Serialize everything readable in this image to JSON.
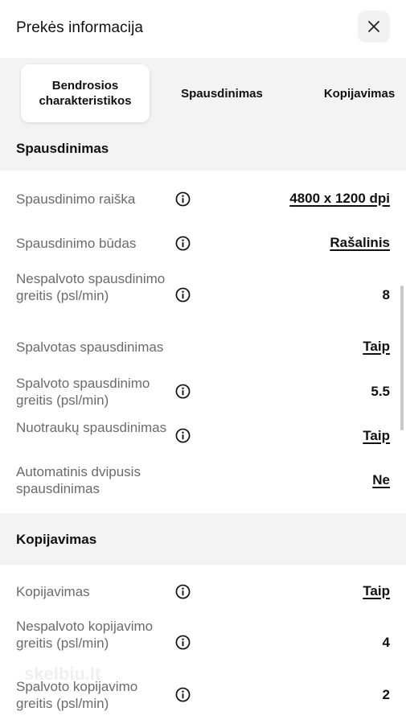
{
  "header": {
    "title": "Prekės informacija"
  },
  "tabs": [
    {
      "label": "Bendrosios charakteristikos"
    },
    {
      "label": "Spausdinimas"
    },
    {
      "label": "Kopijavimas"
    }
  ],
  "sections": [
    {
      "title": "Spausdinimas",
      "rows": [
        {
          "label": "Spausdinimo raiška",
          "value": "4800 x 1200 dpi"
        },
        {
          "label": "Spausdinimo būdas",
          "value": "Rašalinis"
        },
        {
          "label": "Nespalvoto spausdinimo greitis (psl/min)",
          "value": "8"
        },
        {
          "label": "Spalvotas spausdinimas",
          "value": "Taip"
        },
        {
          "label": "Spalvoto spausdinimo greitis (psl/min)",
          "value": "5.5"
        },
        {
          "label": "Nuotraukų spausdinimas",
          "value": "Taip"
        },
        {
          "label": "Automatinis dvipusis spausdinimas",
          "value": "Ne"
        }
      ]
    },
    {
      "title": "Kopijavimas",
      "rows": [
        {
          "label": "Kopijavimas",
          "value": "Taip"
        },
        {
          "label": "Nespalvoto kopijavimo greitis (psl/min)",
          "value": "4"
        },
        {
          "label": "Spalvoto kopijavimo greitis (psl/min)",
          "value": "2"
        }
      ]
    }
  ],
  "watermark": "skelbiu.lt",
  "icons": {
    "close": "close-icon",
    "info": "info-icon"
  }
}
